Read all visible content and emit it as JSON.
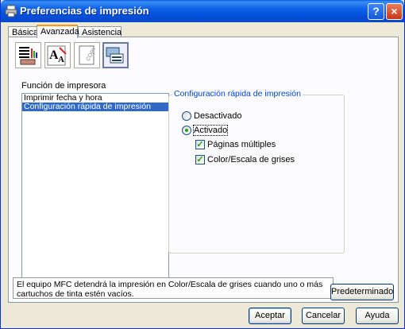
{
  "window": {
    "title": "Preferencias de impresión",
    "help_label": "?",
    "close_label": "×"
  },
  "tabs": [
    {
      "label": "Básica"
    },
    {
      "label": "Avanzada"
    },
    {
      "label": "Asistencia"
    }
  ],
  "toolbar_icons": [
    {
      "name": "printer-quality-icon"
    },
    {
      "name": "text-scaling-icon"
    },
    {
      "name": "copy-watermark-icon"
    },
    {
      "name": "device-options-icon"
    }
  ],
  "function_list": {
    "label": "Función de impresora",
    "items": [
      {
        "label": "Imprimir fecha y hora",
        "selected": false
      },
      {
        "label": "Configuración rápida de impresión",
        "selected": true
      }
    ]
  },
  "quick_setup": {
    "group_title": "Configuración rápida de impresión",
    "off_label": "Desactivado",
    "on_label": "Activado",
    "selected": "on",
    "multi_page_label": "Páginas múltiples",
    "multi_page_checked": true,
    "color_label": "Color/Escala de grises",
    "color_checked": true
  },
  "info_text": "El equipo MFC detendrá la impresión en Color/Escala de grises cuando uno o más cartuchos de tinta estén vacíos.",
  "buttons": {
    "default": "Predeterminado",
    "ok": "Aceptar",
    "cancel": "Cancelar",
    "help": "Ayuda"
  },
  "colors": {
    "titlebar": "#0350db",
    "selection": "#316ac5",
    "group_title": "#0046d5",
    "check_green": "#21a121"
  }
}
